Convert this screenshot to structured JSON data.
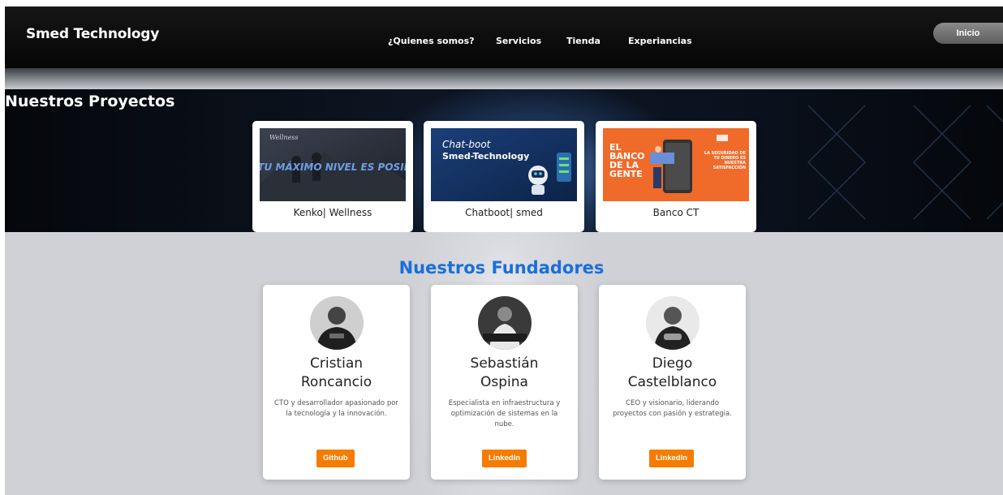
{
  "header": {
    "brand": "Smed Technology",
    "nav": [
      "¿Quienes somos?",
      "Servicios",
      "Tienda",
      "Experiancias"
    ],
    "login_label": "Inicio"
  },
  "projects": {
    "title": "Nuestros Proyectos",
    "items": [
      {
        "label": "Kenko| Wellness",
        "thumb_text": "TU MÁXIMO NIVEL ES POSIBLE",
        "thumb_small": "Wellness"
      },
      {
        "label": "Chatboot| smed",
        "thumb_text1": "Chat-boot",
        "thumb_text2": "Smed-Technology"
      },
      {
        "label": "Banco CT",
        "thumb_text": "EL BANCO DE LA GENTE",
        "thumb_side": "LA SEGURIDAD DE TU DINERO ES NUESTRA SATISFACCIÓN"
      }
    ]
  },
  "founders": {
    "title": "Nuestros Fundadores",
    "items": [
      {
        "first": "Cristian",
        "last": "Roncancio",
        "desc": "CTO y desarrollador apasionado por la tecnología y la innovación.",
        "button": "Github"
      },
      {
        "first": "Sebastián",
        "last": "Ospina",
        "desc": "Especialista en infraestructura y optimización de sistemas en la nube.",
        "button": "LinkedIn"
      },
      {
        "first": "Diego",
        "last": "Castelblanco",
        "desc": "CEO y visionario, liderando proyectos con pasión y estrategia.",
        "button": "LinkedIn"
      }
    ]
  },
  "colors": {
    "accent_blue": "#1a6fd8",
    "button_orange": "#f57c00",
    "header_black": "#0a0a0a"
  }
}
